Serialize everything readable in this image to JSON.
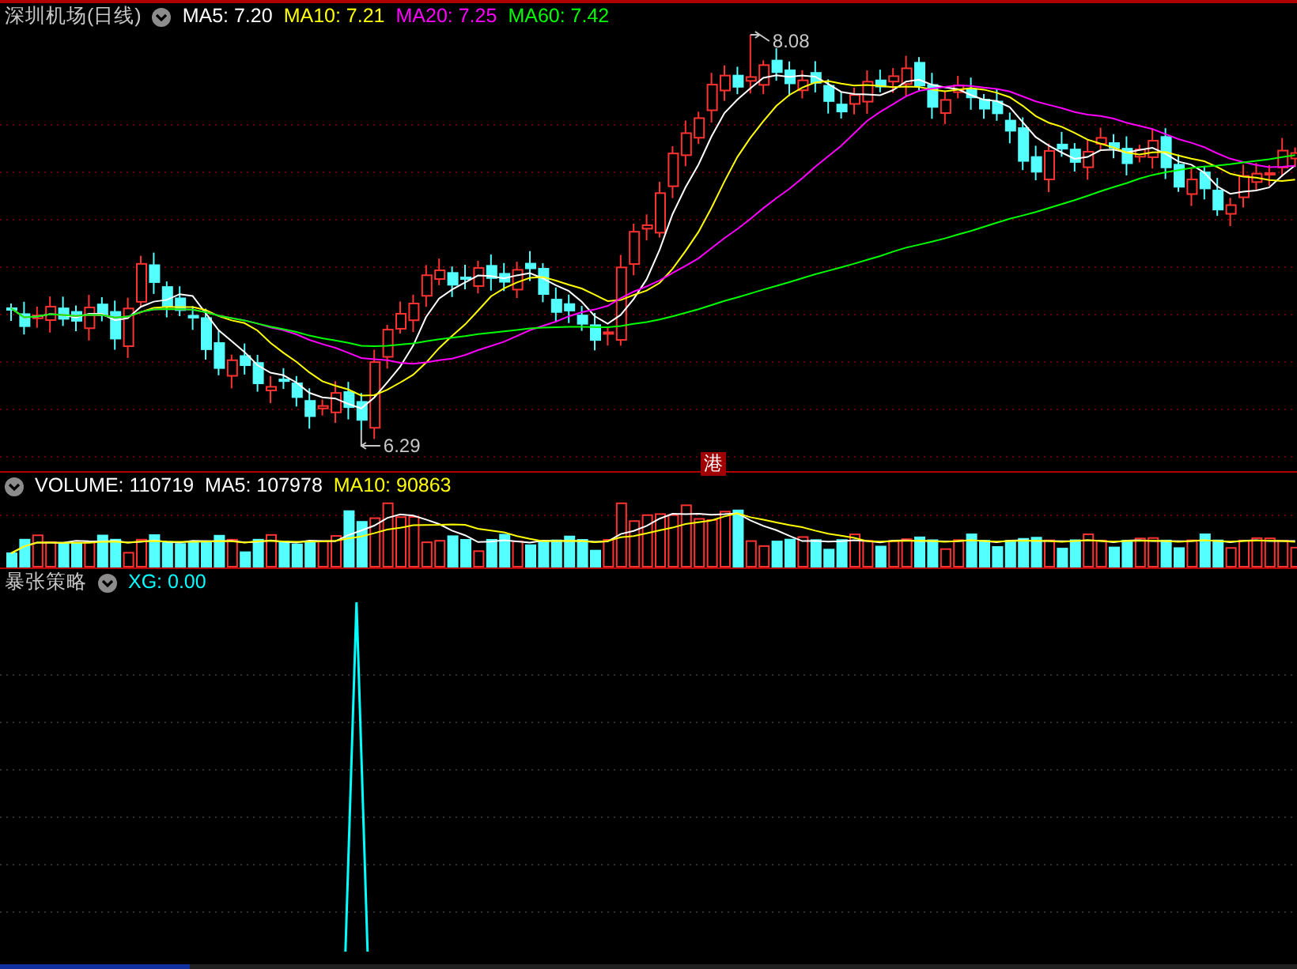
{
  "price_panel": {
    "title": "深圳机场(日线)",
    "indicators": [
      {
        "label": "MA5: 7.20",
        "color": "#ffffff"
      },
      {
        "label": "MA10: 7.21",
        "color": "#ffff00"
      },
      {
        "label": "MA20: 7.25",
        "color": "#ff00ff"
      },
      {
        "label": "MA60: 7.42",
        "color": "#00ff00"
      }
    ],
    "high_label": "8.08",
    "low_label": "6.29",
    "marker": "港"
  },
  "volume_panel": {
    "indicators": [
      {
        "label": "VOLUME: 110719",
        "color": "#ffffff"
      },
      {
        "label": "MA5: 107978",
        "color": "#ffffff"
      },
      {
        "label": "MA10: 90863",
        "color": "#ffff00"
      }
    ]
  },
  "signal_panel": {
    "title": "暴张策略",
    "indicators": [
      {
        "label": "XG: 0.00",
        "color": "#00ffff"
      }
    ]
  }
}
